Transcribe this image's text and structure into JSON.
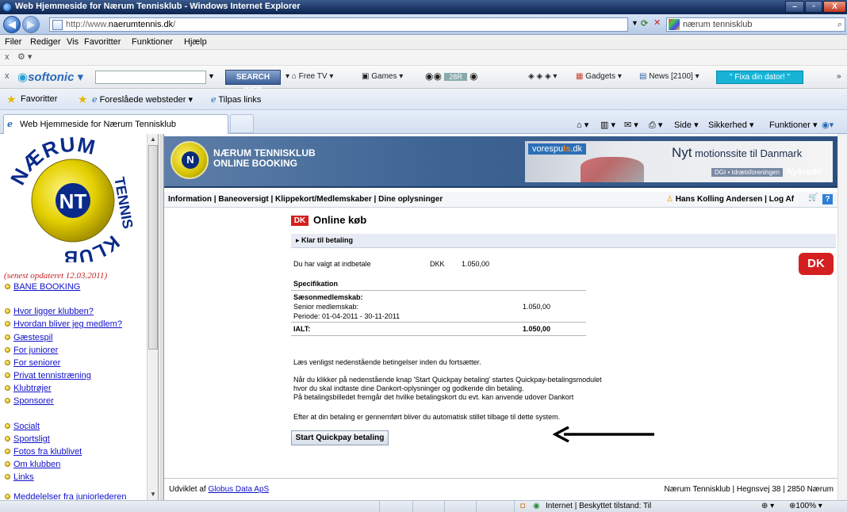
{
  "window": {
    "title": "Web Hjemmeside for Nærum Tennisklub - Windows Internet Explorer",
    "minimize": "–",
    "maximize": "▫",
    "close": "X"
  },
  "address": {
    "url_prefix": "http://www.",
    "url_domain": "naerumtennis.dk",
    "url_suffix": "/",
    "search_text": "nærum tennisklub"
  },
  "menu": [
    "Filer",
    "Rediger",
    "Vis",
    "Favoritter",
    "Funktioner",
    "Hjælp"
  ],
  "softonic": {
    "brand": "softonic",
    "search_btn": "SEARCH WEB",
    "free_tv": "Free TV",
    "games": "Games",
    "radio_value": "28R",
    "gadgets": "Gadgets",
    "news": "News [2100]",
    "fixa": "\" Fixa din dator! \""
  },
  "favorites": {
    "favoritter": "Favoritter",
    "suggested": "Foreslåede websteder",
    "tilpas": "Tilpas links"
  },
  "tab": {
    "title": "Web Hjemmeside for Nærum Tennisklub"
  },
  "commandbar": {
    "side": "Side",
    "sikkerhed": "Sikkerhed",
    "funktioner": "Funktioner"
  },
  "left": {
    "logo_top": "NÆRUM",
    "logo_right": "TENNIS",
    "logo_bottom": "KLUB",
    "logo_center": "NT",
    "updated": "(senest opdateret 12.03.2011)",
    "links": [
      "BANE BOOKING",
      "Hvor ligger klubben?",
      "Hvordan bliver jeg medlem?",
      "Gæstespil",
      "For juniorer",
      "For seniorer",
      "Privat tennistræning",
      "Klubtrøjer",
      "Sponsorer",
      "Socialt",
      "Sportsligt",
      "Fotos fra klublivet",
      "Om klubben",
      "Links",
      "Meddelelser fra juniorlederen"
    ]
  },
  "header": {
    "line1": "NÆRUM TENNISKLUB",
    "line2": "ONLINE BOOKING",
    "logo_letter": "N"
  },
  "ad": {
    "brand_a": "vorespu",
    "brand_b": "ls",
    "brand_c": ".dk",
    "title": "Nyt",
    "title_rest": " motionssite til Danmark",
    "sub": "DGI • Idrætsforeningen",
    "nykredit": "Nykredit"
  },
  "subnav": {
    "links": "Information | Baneoversigt | Klippekort/Medlemskaber | Dine oplysninger",
    "user": "Hans Kolling Andersen | Log Af",
    "help": "?"
  },
  "payment": {
    "dk_logo": "DK",
    "title": "Online køb",
    "status": "Klar til betaling",
    "chosen_label": "Du har valgt at indbetale",
    "currency": "DKK",
    "amount": "1.050,00",
    "spec_heading": "Specifikation",
    "membership_heading": "Sæsonmedlemskab:",
    "item_label": "Senior medlemskab:",
    "item_amount": "1.050,00",
    "period": "Periode: 01-04-2011 - 30-11-2011",
    "total_label": "IALT:",
    "total_amount": "1.050,00",
    "read_terms": "Læs venligst nedenstående betingelser inden du fortsætter.",
    "info1": "Når du klikker på nedenstående knap 'Start Quickpay betaling' startes Quickpay-betalingsmodulet",
    "info2": "hvor du skal indtaste dine Dankort-oplysninger og godkende din betaling.",
    "info3": "På betalingsbilledet fremgår det hvilke betalingskort du evt. kan anvende udover Dankort",
    "info4": "Efter at din betaling er gennemført bliver du automatisk stillet tilbage til dette system.",
    "button": "Start Quickpay betaling"
  },
  "footer": {
    "prefix": "Udviklet af",
    "link": "Globus Data ApS",
    "address": "Nærum Tennisklub | Hegnsvej 38 | 2850 Nærum"
  },
  "statusbar": {
    "zone": "Internet | Beskyttet tilstand: Til",
    "zoom": "100%"
  }
}
